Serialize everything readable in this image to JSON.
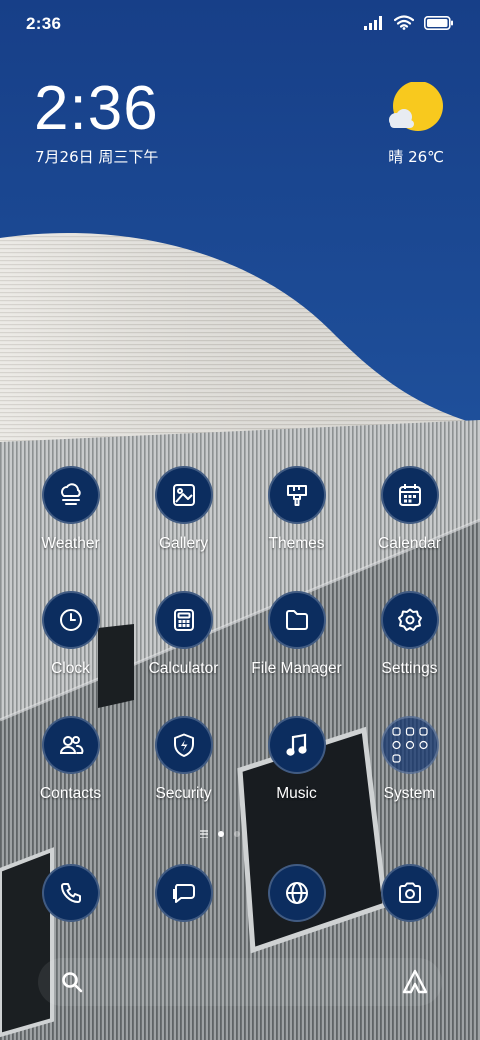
{
  "status_bar": {
    "time": "2:36",
    "icons": [
      "signal-icon",
      "wifi-icon",
      "battery-icon"
    ]
  },
  "clock_widget": {
    "time": "2:36",
    "date": "7月26日 周三下午"
  },
  "weather_widget": {
    "icon": "sunny-icon",
    "text": "晴 26℃"
  },
  "apps": [
    {
      "label": "Weather",
      "icon": "weather-icon"
    },
    {
      "label": "Gallery",
      "icon": "gallery-icon"
    },
    {
      "label": "Themes",
      "icon": "themes-icon"
    },
    {
      "label": "Calendar",
      "icon": "calendar-icon"
    },
    {
      "label": "Clock",
      "icon": "clock-icon"
    },
    {
      "label": "Calculator",
      "icon": "calculator-icon"
    },
    {
      "label": "File Manager",
      "icon": "folder-icon"
    },
    {
      "label": "Settings",
      "icon": "gear-icon"
    },
    {
      "label": "Contacts",
      "icon": "contacts-icon"
    },
    {
      "label": "Security",
      "icon": "shield-icon"
    },
    {
      "label": "Music",
      "icon": "music-note-icon"
    },
    {
      "label": "System",
      "icon": "folder-grid-icon"
    }
  ],
  "dock": [
    {
      "icon": "phone-icon"
    },
    {
      "icon": "messages-icon"
    },
    {
      "icon": "browser-globe-icon"
    },
    {
      "icon": "camera-icon"
    }
  ],
  "search_bar": {
    "left_icon": "search-icon",
    "right_icon": "assistant-icon"
  },
  "colors": {
    "sky": "#1d4d96",
    "icon_bg": "#0c2d5f",
    "sun": "#f8c91e"
  }
}
